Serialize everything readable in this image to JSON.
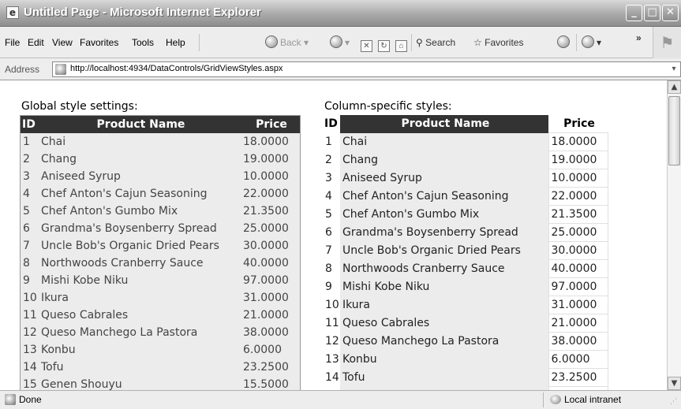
{
  "window": {
    "title": "Untitled Page - Microsoft Internet Explorer"
  },
  "menu": [
    "File",
    "Edit",
    "View",
    "Favorites",
    "Tools",
    "Help"
  ],
  "toolbar": {
    "back": "Back",
    "search": "Search",
    "favorites": "Favorites"
  },
  "address": {
    "label": "Address",
    "url": "http://localhost:4934/DataControls/GridViewStyles.aspx"
  },
  "sections": {
    "global": "Global style settings:",
    "column": "Column-specific styles:"
  },
  "grid_headers": {
    "id": "ID",
    "name": "Product Name",
    "price": "Price"
  },
  "products": [
    {
      "id": "1",
      "name": "Chai",
      "price": "18.0000"
    },
    {
      "id": "2",
      "name": "Chang",
      "price": "19.0000"
    },
    {
      "id": "3",
      "name": "Aniseed Syrup",
      "price": "10.0000"
    },
    {
      "id": "4",
      "name": "Chef Anton's Cajun Seasoning",
      "price": "22.0000"
    },
    {
      "id": "5",
      "name": "Chef Anton's Gumbo Mix",
      "price": "21.3500"
    },
    {
      "id": "6",
      "name": "Grandma's Boysenberry Spread",
      "price": "25.0000"
    },
    {
      "id": "7",
      "name": "Uncle Bob's Organic Dried Pears",
      "price": "30.0000"
    },
    {
      "id": "8",
      "name": "Northwoods Cranberry Sauce",
      "price": "40.0000"
    },
    {
      "id": "9",
      "name": "Mishi Kobe Niku",
      "price": "97.0000"
    },
    {
      "id": "10",
      "name": "Ikura",
      "price": "31.0000"
    },
    {
      "id": "11",
      "name": "Queso Cabrales",
      "price": "21.0000"
    },
    {
      "id": "12",
      "name": "Queso Manchego La Pastora",
      "price": "38.0000"
    },
    {
      "id": "13",
      "name": "Konbu",
      "price": "6.0000"
    },
    {
      "id": "14",
      "name": "Tofu",
      "price": "23.2500"
    },
    {
      "id": "15",
      "name": "Genen Shouyu",
      "price": "15.5000"
    }
  ],
  "status": {
    "text": "Done",
    "zone": "Local intranet"
  }
}
